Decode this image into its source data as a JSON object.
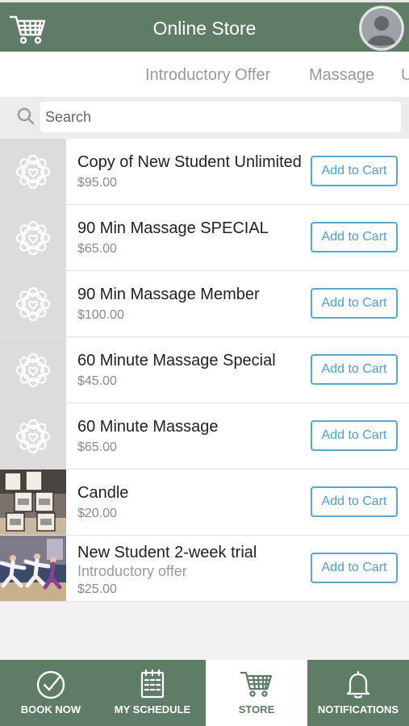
{
  "header": {
    "title": "Online Store",
    "cart_icon": "cart-icon",
    "avatar_icon": "user-avatar-icon"
  },
  "tabs": [
    {
      "label": "Introductory Offer"
    },
    {
      "label": "Massage"
    },
    {
      "label": "U"
    }
  ],
  "search": {
    "placeholder": "Search",
    "value": ""
  },
  "products": [
    {
      "name": "Copy of New Student Unlimited",
      "price": "$95.00",
      "button": "Add to Cart",
      "thumb": "logo-placeholder"
    },
    {
      "name": "90 Min Massage SPECIAL",
      "price": "$65.00",
      "button": "Add to Cart",
      "thumb": "logo-placeholder"
    },
    {
      "name": "90 Min Massage Member",
      "price": "$100.00",
      "button": "Add to Cart",
      "thumb": "logo-placeholder"
    },
    {
      "name": "60 Minute Massage Special",
      "price": "$45.00",
      "button": "Add to Cart",
      "thumb": "logo-placeholder"
    },
    {
      "name": "60 Minute Massage",
      "price": "$65.00",
      "button": "Add to Cart",
      "thumb": "logo-placeholder"
    },
    {
      "name": "Candle",
      "price": "$20.00",
      "button": "Add to Cart",
      "thumb": "candle-photo"
    },
    {
      "name": "New Student 2-week trial",
      "subtitle": "Introductory offer",
      "price": "$25.00",
      "button": "Add to Cart",
      "thumb": "yoga-class-photo"
    }
  ],
  "nav": [
    {
      "label": "BOOK NOW",
      "icon": "check-circle-icon"
    },
    {
      "label": "MY SCHEDULE",
      "icon": "calendar-icon"
    },
    {
      "label": "STORE",
      "icon": "cart-icon"
    },
    {
      "label": "NOTIFICATIONS",
      "icon": "bell-icon"
    }
  ],
  "colors": {
    "brand": "#5f7d66",
    "accent": "#4a9fd4",
    "background": "#f2f2f2"
  }
}
